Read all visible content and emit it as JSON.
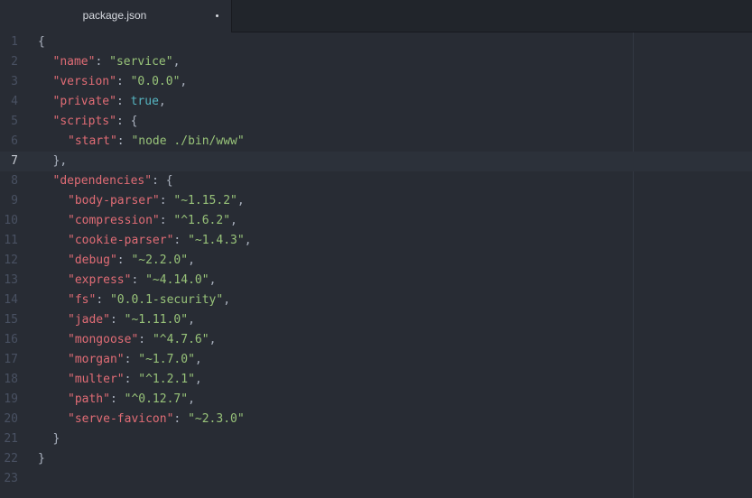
{
  "tab": {
    "title": "package.json",
    "modified_indicator": "•"
  },
  "editor": {
    "current_line": 7,
    "lines": [
      {
        "n": "1",
        "indent": 0,
        "tokens": [
          {
            "t": "punc",
            "v": "{"
          }
        ]
      },
      {
        "n": "2",
        "indent": 1,
        "tokens": [
          {
            "t": "key",
            "v": "\"name\""
          },
          {
            "t": "punc",
            "v": ": "
          },
          {
            "t": "str",
            "v": "\"service\""
          },
          {
            "t": "punc",
            "v": ","
          }
        ]
      },
      {
        "n": "3",
        "indent": 1,
        "tokens": [
          {
            "t": "key",
            "v": "\"version\""
          },
          {
            "t": "punc",
            "v": ": "
          },
          {
            "t": "str",
            "v": "\"0.0.0\""
          },
          {
            "t": "punc",
            "v": ","
          }
        ]
      },
      {
        "n": "4",
        "indent": 1,
        "tokens": [
          {
            "t": "key",
            "v": "\"private\""
          },
          {
            "t": "punc",
            "v": ": "
          },
          {
            "t": "bool",
            "v": "true"
          },
          {
            "t": "punc",
            "v": ","
          }
        ]
      },
      {
        "n": "5",
        "indent": 1,
        "tokens": [
          {
            "t": "key",
            "v": "\"scripts\""
          },
          {
            "t": "punc",
            "v": ": {"
          }
        ]
      },
      {
        "n": "6",
        "indent": 2,
        "tokens": [
          {
            "t": "key",
            "v": "\"start\""
          },
          {
            "t": "punc",
            "v": ": "
          },
          {
            "t": "str",
            "v": "\"node ./bin/www\""
          }
        ]
      },
      {
        "n": "7",
        "indent": 1,
        "tokens": [
          {
            "t": "punc",
            "v": "},"
          }
        ]
      },
      {
        "n": "8",
        "indent": 1,
        "tokens": [
          {
            "t": "key",
            "v": "\"dependencies\""
          },
          {
            "t": "punc",
            "v": ": {"
          }
        ]
      },
      {
        "n": "9",
        "indent": 2,
        "tokens": [
          {
            "t": "key",
            "v": "\"body-parser\""
          },
          {
            "t": "punc",
            "v": ": "
          },
          {
            "t": "str",
            "v": "\"~1.15.2\""
          },
          {
            "t": "punc",
            "v": ","
          }
        ]
      },
      {
        "n": "10",
        "indent": 2,
        "tokens": [
          {
            "t": "key",
            "v": "\"compression\""
          },
          {
            "t": "punc",
            "v": ": "
          },
          {
            "t": "str",
            "v": "\"^1.6.2\""
          },
          {
            "t": "punc",
            "v": ","
          }
        ]
      },
      {
        "n": "11",
        "indent": 2,
        "tokens": [
          {
            "t": "key",
            "v": "\"cookie-parser\""
          },
          {
            "t": "punc",
            "v": ": "
          },
          {
            "t": "str",
            "v": "\"~1.4.3\""
          },
          {
            "t": "punc",
            "v": ","
          }
        ]
      },
      {
        "n": "12",
        "indent": 2,
        "tokens": [
          {
            "t": "key",
            "v": "\"debug\""
          },
          {
            "t": "punc",
            "v": ": "
          },
          {
            "t": "str",
            "v": "\"~2.2.0\""
          },
          {
            "t": "punc",
            "v": ","
          }
        ]
      },
      {
        "n": "13",
        "indent": 2,
        "tokens": [
          {
            "t": "key",
            "v": "\"express\""
          },
          {
            "t": "punc",
            "v": ": "
          },
          {
            "t": "str",
            "v": "\"~4.14.0\""
          },
          {
            "t": "punc",
            "v": ","
          }
        ]
      },
      {
        "n": "14",
        "indent": 2,
        "tokens": [
          {
            "t": "key",
            "v": "\"fs\""
          },
          {
            "t": "punc",
            "v": ": "
          },
          {
            "t": "str",
            "v": "\"0.0.1-security\""
          },
          {
            "t": "punc",
            "v": ","
          }
        ]
      },
      {
        "n": "15",
        "indent": 2,
        "tokens": [
          {
            "t": "key",
            "v": "\"jade\""
          },
          {
            "t": "punc",
            "v": ": "
          },
          {
            "t": "str",
            "v": "\"~1.11.0\""
          },
          {
            "t": "punc",
            "v": ","
          }
        ]
      },
      {
        "n": "16",
        "indent": 2,
        "tokens": [
          {
            "t": "key",
            "v": "\"mongoose\""
          },
          {
            "t": "punc",
            "v": ": "
          },
          {
            "t": "str",
            "v": "\"^4.7.6\""
          },
          {
            "t": "punc",
            "v": ","
          }
        ]
      },
      {
        "n": "17",
        "indent": 2,
        "tokens": [
          {
            "t": "key",
            "v": "\"morgan\""
          },
          {
            "t": "punc",
            "v": ": "
          },
          {
            "t": "str",
            "v": "\"~1.7.0\""
          },
          {
            "t": "punc",
            "v": ","
          }
        ]
      },
      {
        "n": "18",
        "indent": 2,
        "tokens": [
          {
            "t": "key",
            "v": "\"multer\""
          },
          {
            "t": "punc",
            "v": ": "
          },
          {
            "t": "str",
            "v": "\"^1.2.1\""
          },
          {
            "t": "punc",
            "v": ","
          }
        ]
      },
      {
        "n": "19",
        "indent": 2,
        "tokens": [
          {
            "t": "key",
            "v": "\"path\""
          },
          {
            "t": "punc",
            "v": ": "
          },
          {
            "t": "str",
            "v": "\"^0.12.7\""
          },
          {
            "t": "punc",
            "v": ","
          }
        ]
      },
      {
        "n": "20",
        "indent": 2,
        "tokens": [
          {
            "t": "key",
            "v": "\"serve-favicon\""
          },
          {
            "t": "punc",
            "v": ": "
          },
          {
            "t": "str",
            "v": "\"~2.3.0\""
          }
        ]
      },
      {
        "n": "21",
        "indent": 1,
        "tokens": [
          {
            "t": "punc",
            "v": "}"
          }
        ]
      },
      {
        "n": "22",
        "indent": 0,
        "tokens": [
          {
            "t": "punc",
            "v": "}"
          }
        ]
      },
      {
        "n": "23",
        "indent": 0,
        "tokens": []
      }
    ]
  },
  "colors": {
    "background": "#282c34",
    "tabbar": "#21252b",
    "key": "#e06c75",
    "string": "#98c379",
    "boolean": "#56b6c2",
    "punctuation": "#abb2bf",
    "line_number": "#495162",
    "current_line_highlight": "#2c313a"
  }
}
